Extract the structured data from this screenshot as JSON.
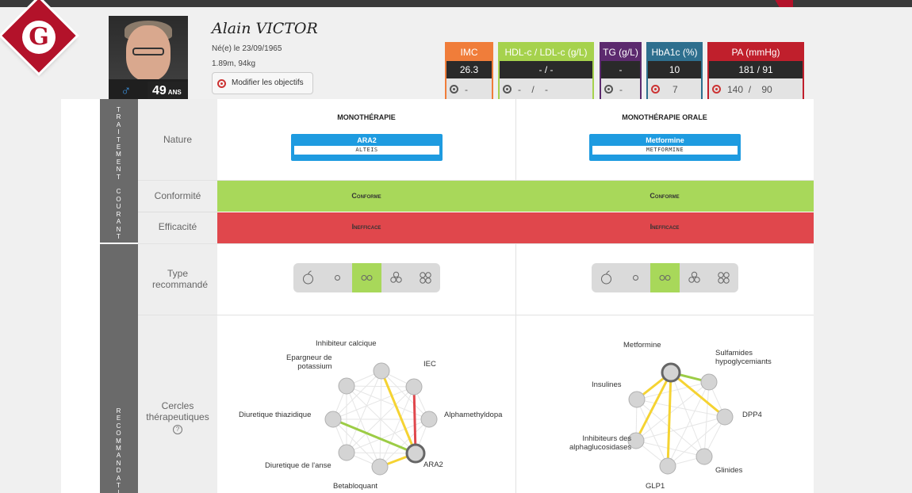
{
  "colors": {
    "brand": "#b3122a",
    "conforme": "#a8d85a",
    "inefficace": "#e0474c",
    "drug": "#1e9be0"
  },
  "patient": {
    "name": "Alain VICTOR",
    "dob": "Né(e) le 23/09/1965",
    "measurements": "1.89m, 94kg",
    "age": "49",
    "age_unit": "ANS",
    "sex_icon": "male-icon",
    "objectives_button": "Modifier les objectifs"
  },
  "logo": {
    "letter": "G"
  },
  "metrics": [
    {
      "label": "IMC",
      "value": "26.3",
      "target": "-",
      "color": "#f07d3a"
    },
    {
      "label": "HDL-c / LDL-c (g/L)",
      "value": "- / -",
      "target": "-    /    -",
      "color": "#a6d24d"
    },
    {
      "label": "TG (g/L)",
      "value": "-",
      "target": "-",
      "color": "#5c2a6e"
    },
    {
      "label": "HbA1c (%)",
      "value": "10",
      "target": "7",
      "color": "#2e6f8e"
    },
    {
      "label": "PA (mmHg)",
      "value": "181 / 91",
      "target": "140  /    90",
      "color": "#c01f2c"
    }
  ],
  "sections": {
    "traitement_courant": "TRAITEMENT COURANT",
    "recommandation": "RECOMMANDATI"
  },
  "rows": {
    "nature": "Nature",
    "conformite": "Conformité",
    "efficacite": "Efficacité",
    "type": "Type recommandé",
    "cercles": "Cercles thérapeutiques",
    "help": "?"
  },
  "columns": [
    {
      "title": "MONOTHÉRAPIE",
      "drug": "ARA2",
      "drug_sub": "ALTEIS",
      "conformite": "Conforme",
      "efficacite": "Inefficace",
      "active_type": 2,
      "circle_labels": [
        "Inhibiteur calcique",
        "IEC",
        "Alphamethyldopa",
        "ARA2",
        "Betabloquant",
        "Diuretique de l'anse",
        "Diuretique thiazidique",
        "Epargneur de\npotassium"
      ]
    },
    {
      "title": "MONOTHÉRAPIE ORALE",
      "drug": "Metformine",
      "drug_sub": "METFORMINE",
      "conformite": "Conforme",
      "efficacite": "Inefficace",
      "active_type": 2,
      "circle_labels": [
        "Metformine",
        "Sulfamides\nhypoglycemiants",
        "DPP4",
        "Glinides",
        "GLP1",
        "Inhibiteurs des\nalphaglucosidases",
        "Insulines"
      ]
    }
  ]
}
